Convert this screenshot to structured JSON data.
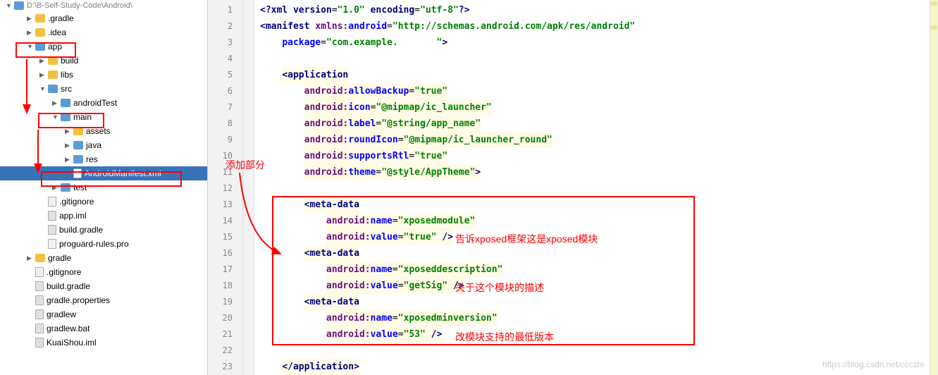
{
  "breadcrumb": "D:\\B-Self-Study-Code\\Android\\",
  "tree": {
    "items": [
      {
        "label": ".gradle",
        "icon": "folder",
        "indent": 1,
        "expander": "▶"
      },
      {
        "label": ".idea",
        "icon": "folder",
        "indent": 1,
        "expander": "▶"
      },
      {
        "label": "app",
        "icon": "folder-blue",
        "indent": 1,
        "expander": "▼",
        "highlighted": true
      },
      {
        "label": "build",
        "icon": "folder",
        "indent": 2,
        "expander": "▶"
      },
      {
        "label": "libs",
        "icon": "folder",
        "indent": 2,
        "expander": "▶"
      },
      {
        "label": "src",
        "icon": "folder-blue",
        "indent": 2,
        "expander": "▼"
      },
      {
        "label": "androidTest",
        "icon": "folder-blue",
        "indent": 3,
        "expander": "▶"
      },
      {
        "label": "main",
        "icon": "folder-blue",
        "indent": 3,
        "expander": "▼",
        "highlighted": true
      },
      {
        "label": "assets",
        "icon": "folder",
        "indent": 4,
        "expander": "▶"
      },
      {
        "label": "java",
        "icon": "folder-blue",
        "indent": 4,
        "expander": "▶"
      },
      {
        "label": "res",
        "icon": "folder-blue",
        "indent": 4,
        "expander": "▶"
      },
      {
        "label": "AndroidManifest.xml",
        "icon": "file-mf",
        "indent": 4,
        "expander": "",
        "selected": true,
        "highlighted": true
      },
      {
        "label": "test",
        "icon": "folder-blue",
        "indent": 3,
        "expander": "▶"
      },
      {
        "label": ".gitignore",
        "icon": "file-txt",
        "indent": 2,
        "expander": ""
      },
      {
        "label": "app.iml",
        "icon": "file",
        "indent": 2,
        "expander": ""
      },
      {
        "label": "build.gradle",
        "icon": "file",
        "indent": 2,
        "expander": ""
      },
      {
        "label": "proguard-rules.pro",
        "icon": "file-txt",
        "indent": 2,
        "expander": ""
      },
      {
        "label": "gradle",
        "icon": "folder",
        "indent": 1,
        "expander": "▶"
      },
      {
        "label": ".gitignore",
        "icon": "file-txt",
        "indent": 1,
        "expander": ""
      },
      {
        "label": "build.gradle",
        "icon": "file",
        "indent": 1,
        "expander": ""
      },
      {
        "label": "gradle.properties",
        "icon": "file",
        "indent": 1,
        "expander": ""
      },
      {
        "label": "gradlew",
        "icon": "file",
        "indent": 1,
        "expander": ""
      },
      {
        "label": "gradlew.bat",
        "icon": "file",
        "indent": 1,
        "expander": ""
      },
      {
        "label": "KuaiShou.iml",
        "icon": "file",
        "indent": 1,
        "expander": ""
      }
    ]
  },
  "code": {
    "lines": [
      {
        "n": 1,
        "html": "<span class='bracket'>&lt;?</span><span class='tag'>xml version</span><span>=</span><span class='attr-val'>\"1.0\"</span> <span class='tag'>encoding</span><span>=</span><span class='attr-val'>\"utf-8\"</span><span class='bracket'>?&gt;</span>"
      },
      {
        "n": 2,
        "html": "<span class='bracket'>&lt;</span><span class='tag'>manifest</span> <span class='attr-ns'>xmlns:</span><span class='attr-name'>android</span>=<span class='attr-val'>\"http://schemas.android.com/apk/res/android\"</span>"
      },
      {
        "n": 3,
        "html": "    <span class='attr-name'>package</span>=<span class='attr-val'>\"com.example.       \"</span><span class='bracket'>&gt;</span>"
      },
      {
        "n": 4,
        "html": ""
      },
      {
        "n": 5,
        "html": "    <span class='hl-bg'><span class='bracket'>&lt;</span><span class='tag'>application</span></span>",
        "hl": true
      },
      {
        "n": 6,
        "html": "        <span class='hl-bg'><span class='attr-ns'>android:</span><span class='attr-name'>allowBackup</span>=<span class='attr-val'>\"true\"</span></span>",
        "hl": true
      },
      {
        "n": 7,
        "html": "        <span class='hl-bg'><span class='attr-ns'>android:</span><span class='attr-name'>icon</span>=<span class='attr-val'>\"@mipmap/ic_launcher\"</span></span>",
        "hl": true
      },
      {
        "n": 8,
        "html": "        <span class='hl-bg'><span class='attr-ns'>android:</span><span class='attr-name'>label</span>=<span class='attr-val'>\"@string/app_name\"</span></span>",
        "hl": true
      },
      {
        "n": 9,
        "html": "        <span class='hl-bg'><span class='attr-ns'>android:</span><span class='attr-name'>roundIcon</span>=<span class='attr-val'>\"@mipmap/ic_launcher_round\"</span></span>",
        "hl": true
      },
      {
        "n": 10,
        "html": "        <span class='hl-bg'><span class='attr-ns'>android:</span><span class='attr-name'>supportsRtl</span>=<span class='attr-val'>\"true\"</span></span>",
        "hl": true
      },
      {
        "n": 11,
        "html": "        <span class='hl-bg'><span class='attr-ns'>android:</span><span class='attr-name'>theme</span>=<span class='attr-val'>\"@style/AppTheme\"</span><span class='bracket'>&gt;</span></span>",
        "hl": true
      },
      {
        "n": 12,
        "html": "",
        "hl": true
      },
      {
        "n": 13,
        "html": "        <span class='hl-bg'><span class='bracket'>&lt;</span><span class='tag'>meta-data</span></span>",
        "hl": true
      },
      {
        "n": 14,
        "html": "            <span class='hl-bg'><span class='attr-ns'>android:</span><span class='attr-name'>name</span>=<span class='attr-val'>\"xposedmodule\"</span></span>",
        "hl": true
      },
      {
        "n": 15,
        "html": "            <span class='hl-bg'><span class='attr-ns'>android:</span><span class='attr-name'>value</span>=<span class='attr-val'>\"true\"</span> <span class='bracket'>/&gt;</span></span>",
        "hl": true
      },
      {
        "n": 16,
        "html": "        <span class='hl-bg'><span class='bracket'>&lt;</span><span class='tag'>meta-data</span></span>",
        "hl": true
      },
      {
        "n": 17,
        "html": "            <span class='hl-bg'><span class='attr-ns'>android:</span><span class='attr-name'>name</span>=<span class='attr-val'>\"xposeddescription\"</span></span>",
        "hl": true
      },
      {
        "n": 18,
        "html": "            <span class='hl-bg'><span class='attr-ns'>android:</span><span class='attr-name'>value</span>=<span class='attr-val'>\"getSig\"</span> <span class='bracket'>/&gt;</span></span>",
        "hl": true
      },
      {
        "n": 19,
        "html": "        <span class='hl-bg'><span class='bracket'>&lt;</span><span class='tag'>meta-data</span></span>",
        "hl": true
      },
      {
        "n": 20,
        "html": "            <span class='hl-bg'><span class='attr-ns'>android:</span><span class='attr-name'>name</span>=<span class='attr-val'>\"xposedminversion\"</span></span>",
        "hl": true
      },
      {
        "n": 21,
        "html": "            <span class='hl-bg'><span class='attr-ns'>android:</span><span class='attr-name'>value</span>=<span class='attr-val'>\"53\"</span> <span class='bracket'>/&gt;</span></span>",
        "hl": true
      },
      {
        "n": 22,
        "html": "",
        "hl": true
      },
      {
        "n": 23,
        "html": "    <span class='hl-bg'><span class='bracket'>&lt;/</span><span class='tag'>application</span><span class='bracket'>&gt;</span></span>",
        "hl": true
      }
    ]
  },
  "annotations": {
    "add_section": "添加部分",
    "comment1": "告诉xposed框架这是xposed模块",
    "comment2": "关于这个模块的描述",
    "comment3": "改模块支持的最低版本"
  },
  "watermark": "https://blog.csdn.net/ccczhi"
}
